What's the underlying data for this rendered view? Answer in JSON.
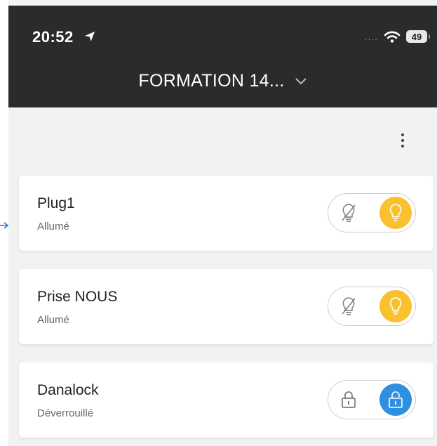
{
  "status_bar": {
    "time": "20:52",
    "signal": "....",
    "battery": "49",
    "location_icon": "location-arrow-icon",
    "wifi_icon": "wifi-icon"
  },
  "header": {
    "title": "FORMATION 14...",
    "dropdown_icon": "chevron-down-icon"
  },
  "menu": {
    "icon": "more-vertical-icon"
  },
  "devices": [
    {
      "name": "Plug1",
      "state": "Allumé",
      "type": "plug",
      "off_icon": "bulb-off-icon",
      "on_icon": "bulb-icon",
      "active_color": "#F9C12E"
    },
    {
      "name": "Prise NOUS",
      "state": "Allumé",
      "type": "plug",
      "off_icon": "bulb-off-icon",
      "on_icon": "bulb-icon",
      "active_color": "#F9C12E"
    },
    {
      "name": "Danalock",
      "state": "Déverrouillé",
      "type": "lock",
      "off_icon": "lock-icon",
      "on_icon": "unlock-icon",
      "active_color": "#2F8FE0"
    }
  ],
  "colors": {
    "header_bg": "#2B2B2B",
    "page_bg": "#F2F2F2",
    "arrow": "#2E6FD8"
  }
}
